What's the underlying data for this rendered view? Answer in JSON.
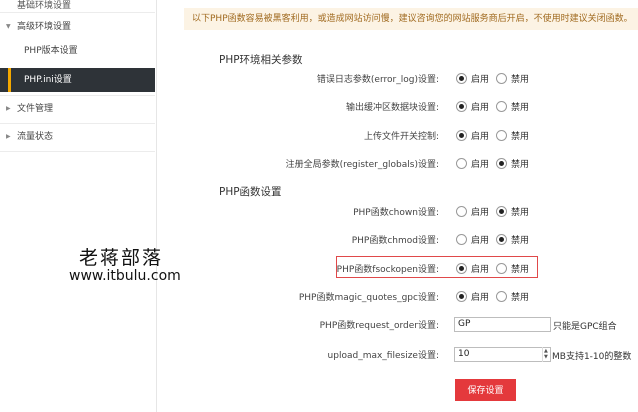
{
  "sidebar": {
    "partial_top": "基础环境设置",
    "items": [
      {
        "label": "高级环境设置",
        "expanded": true
      },
      {
        "label": "PHP版本设置"
      },
      {
        "label": "PHP.ini设置",
        "active": true
      },
      {
        "label": "文件管理"
      },
      {
        "label": "流量状态"
      }
    ]
  },
  "notice": "以下PHP函数容易被黑客利用，或造成网站访问慢，建议咨询您的网站服务商后开启，不使用时建议关闭函数。",
  "env_section": {
    "title": "PHP环境相关参数",
    "rows": [
      {
        "label": "错误日志参数(error_log)设置:",
        "on": "启用",
        "off": "禁用",
        "selected": "on"
      },
      {
        "label": "输出缓冲区数据块设置:",
        "on": "启用",
        "off": "禁用",
        "selected": "on"
      },
      {
        "label": "上传文件开关控制:",
        "on": "启用",
        "off": "禁用",
        "selected": "on"
      },
      {
        "label": "注册全局参数(register_globals)设置:",
        "on": "启用",
        "off": "禁用",
        "selected": "off"
      }
    ]
  },
  "func_section": {
    "title": "PHP函数设置",
    "rows": [
      {
        "label": "PHP函数chown设置:",
        "on": "启用",
        "off": "禁用",
        "selected": "off"
      },
      {
        "label": "PHP函数chmod设置:",
        "on": "启用",
        "off": "禁用",
        "selected": "off"
      },
      {
        "label": "PHP函数fsockopen设置:",
        "on": "启用",
        "off": "禁用",
        "selected": "on"
      },
      {
        "label": "PHP函数magic_quotes_gpc设置:",
        "on": "启用",
        "off": "禁用",
        "selected": "on"
      }
    ],
    "request_order": {
      "label": "PHP函数request_order设置:",
      "value": "GP",
      "hint": "只能是GPC组合"
    },
    "upload_max": {
      "label": "upload_max_filesize设置:",
      "value": "10",
      "hint": "MB支持1-10的整数"
    }
  },
  "save_label": "保存设置",
  "watermark": {
    "line1": "老蒋部落",
    "line2": "www.itbulu.com"
  }
}
